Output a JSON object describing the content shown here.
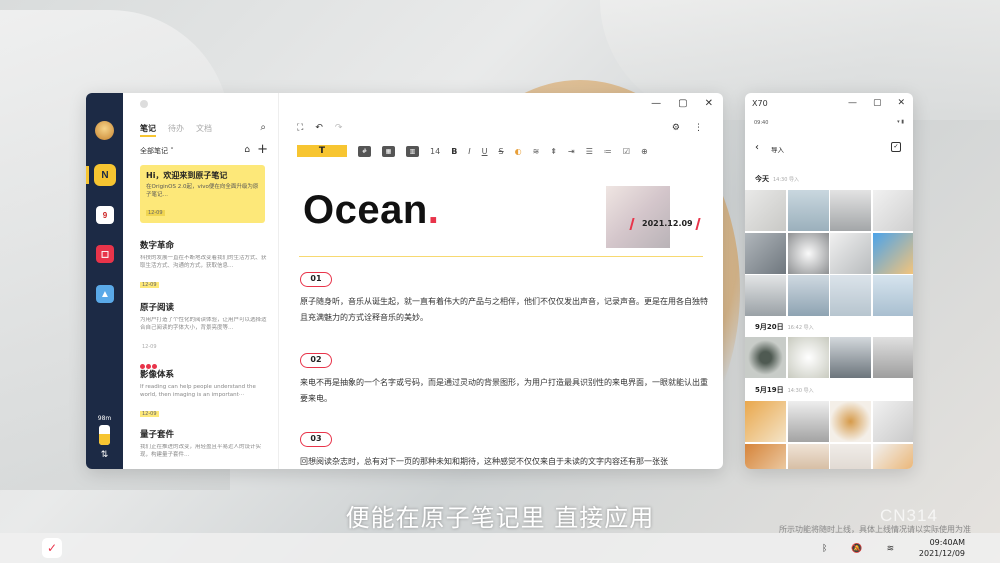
{
  "notes_app": {
    "tabs": [
      "笔记",
      "待办",
      "文档"
    ],
    "filter_label": "全部笔记 ˅",
    "memory_label": "98m",
    "notes": [
      {
        "title": "Hi，欢迎来到原子笔记",
        "desc": "在OriginOS 2.0起，vivo便在向全面升级为原子笔记…",
        "date": "12-09"
      },
      {
        "title": "数字革命",
        "desc": "科技的发展一直在不断地改变着我们的生活方式、获取生活方式、沟通的方式，获取信息…",
        "date": "12-09"
      },
      {
        "title": "原子阅读",
        "desc": "为用户打造了个性化的阅读体验，让用户可以选择适合自己阅读的字体大小，背景亮度等…",
        "date": "12-09"
      },
      {
        "title": "影像体系",
        "desc": "If reading can help people understand the world, then imaging is an important···",
        "date": "12-09"
      },
      {
        "title": "量子套件",
        "desc": "我们正在推进的改变，用轻盈且平易近人的设计实现，构建量子套件…",
        "date": "12-09"
      }
    ]
  },
  "toolbar": {
    "text_style": "T",
    "font_size": "14",
    "bold": "B",
    "italic": "I",
    "underline": "U",
    "strike": "S"
  },
  "document": {
    "title": "Ocean",
    "title_dot": ".",
    "date": "2021.12.09",
    "sections": [
      {
        "num": "01",
        "text": "原子随身听，音乐从诞生起，就一直有着伟大的产品与之相伴，他们不仅仅发出声音，记录声音。更是在用各自独特且充满魅力的方式诠释音乐的美妙。"
      },
      {
        "num": "02",
        "text": "来电不再是抽象的一个名字或号码，而是通过灵动的背景图形，为用户打造最具识别性的来电界面，一眼就能认出重要来电。"
      },
      {
        "num": "03",
        "text": "回想阅读杂志时，总有对下一页的那种未知和期待，这种感觉不仅仅来自于未读的文字内容还有那一张张"
      }
    ]
  },
  "gallery": {
    "window_title": "X70",
    "status_time": "09:40",
    "status_icons": "▾ ▮",
    "import_label": "导入",
    "sections": [
      {
        "label": "今天",
        "meta": "14:30 导入"
      },
      {
        "label": "9月20日",
        "meta": "16:42 导入"
      },
      {
        "label": "5月19日",
        "meta": "14:30 导入"
      }
    ]
  },
  "taskbar": {
    "time": "09:40AM",
    "date": "2021/12/09"
  },
  "overlay": {
    "subtitle": "便能在原子笔记里 直接应用",
    "disclaimer": "所示功能将随时上线，具体上线情况请以实际使用为准",
    "watermark": "CN314"
  },
  "colors": {
    "accent": "#f7c531",
    "red": "#e8344a",
    "rail": "#1c2a45"
  }
}
